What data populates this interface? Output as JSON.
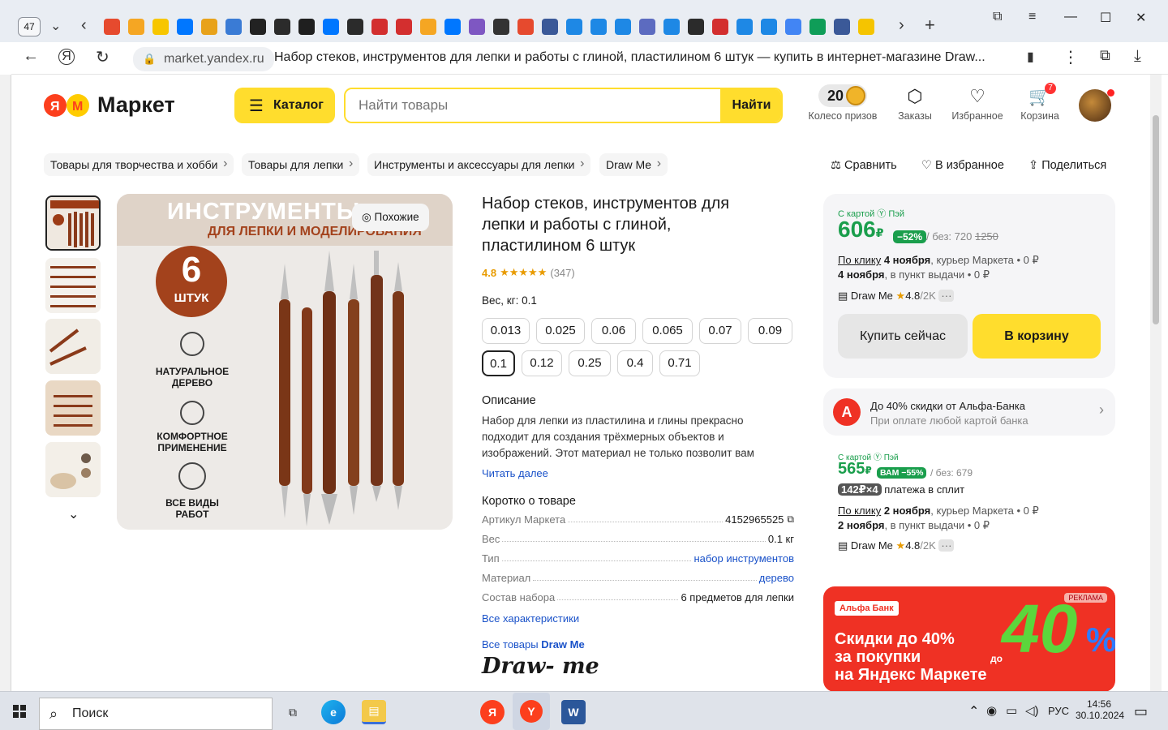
{
  "browser": {
    "tab_count": "47",
    "url": "market.yandex.ru",
    "page_title": "Набор стеков, инструментов для лепки и работы с глиной, пластилином 6 штук — купить в интернет-магазине Draw...",
    "favicon_colors": [
      "#e64a2e",
      "#f5a623",
      "#f7c600",
      "#0077ff",
      "#e8a21a",
      "#3a7bd5",
      "#222222",
      "#2b2b2b",
      "#1f1f1f",
      "#0077ff",
      "#2b2b2b",
      "#d32f2f",
      "#d32f2f",
      "#f5a623",
      "#0077ff",
      "#7e57c2",
      "#333333",
      "#e64a2e",
      "#3b5998",
      "#1e88e5",
      "#1e88e5",
      "#1e88e5",
      "#5c6bc0",
      "#1e88e5",
      "#2b2b2b",
      "#d32f2f",
      "#1e88e5",
      "#1e88e5",
      "#4285f4",
      "#0f9d58",
      "#3b5998",
      "#f5c400"
    ]
  },
  "header": {
    "logo_text": "Маркет",
    "catalog_label": "Каталог",
    "search_placeholder": "Найти товары",
    "search_button": "Найти",
    "wheel_count": "20",
    "wheel_label": "Колесо призов",
    "orders_label": "Заказы",
    "favorites_label": "Избранное",
    "cart_label": "Корзина",
    "cart_badge": "7"
  },
  "breadcrumbs": [
    "Товары для творчества и хобби",
    "Товары для лепки",
    "Инструменты и аксессуары для лепки",
    "Draw Me"
  ],
  "actions": {
    "compare": "Сравнить",
    "favorite": "В избранное",
    "share": "Поделиться"
  },
  "gallery": {
    "similar_label": "Похожие",
    "banner_title": "ИНСТРУМЕНТЫ",
    "banner_subtitle": "ДЛЯ ЛЕПКИ И МОДЕЛИРОВАНИЯ",
    "count_number": "6",
    "count_unit": "ШТУК",
    "features": [
      "НАТУРАЛЬНОЕ ДЕРЕВО",
      "КОМФОРТНОЕ ПРИМЕНЕНИЕ",
      "ВСЕ ВИДЫ РАБОТ"
    ]
  },
  "product": {
    "title": "Набор стеков, инструментов для лепки и работы с глиной, пластилином 6 штук",
    "rating": "4.8",
    "stars": 4.8,
    "reviews": "(347)",
    "weight_label": "Вес, кг: 0.1",
    "weights": [
      "0.013",
      "0.025",
      "0.06",
      "0.065",
      "0.07",
      "0.09",
      "0.1",
      "0.12",
      "0.25",
      "0.4",
      "0.71"
    ],
    "selected_weight": "0.1",
    "description_title": "Описание",
    "description": "Набор для лепки из пластилина и глины прекрасно подходит для создания трёхмерных объектов и изображений. Этот материал не только позволит вам",
    "read_more": "Читать далее",
    "short_title": "Коротко о товаре",
    "specs": [
      {
        "k": "Артикул Маркета",
        "v": "4152965525"
      },
      {
        "k": "Вес",
        "v": "0.1 кг"
      },
      {
        "k": "Тип",
        "v": "набор инструментов"
      },
      {
        "k": "Материал",
        "v": "дерево"
      },
      {
        "k": "Состав набора",
        "v": "6 предметов для лепки"
      }
    ],
    "all_specs": "Все характеристики",
    "all_goods_prefix": "Все товары",
    "brand": "Draw Me",
    "brand_logo_text": "Draw- me"
  },
  "offer1": {
    "card_label": "С картой",
    "pay_label": "Пэй",
    "price": "606",
    "currency": "₽",
    "discount": "−52%",
    "without_label": "/ без: 720",
    "old_price": "1250",
    "delivery1_link": "По клику",
    "delivery1_date": "4 ноября",
    "delivery1_rest": ", курьер Маркета • 0 ₽",
    "delivery2_date": "4 ноября",
    "delivery2_rest": ", в пункт выдачи • 0 ₽",
    "seller": "Draw Me",
    "seller_rating": "4.8",
    "seller_count": "/2K",
    "buy_now": "Купить сейчас",
    "to_cart": "В корзину"
  },
  "alfa_promo": {
    "title": "До 40% скидки от Альфа-Банка",
    "subtitle": "При оплате любой картой банка"
  },
  "offer2": {
    "card_label": "С картой",
    "pay_label": "Пэй",
    "price": "565",
    "currency": "₽",
    "discount": "ВАМ −55%",
    "without_label": "/ без: 679",
    "split_amount": "142₽×4",
    "split_label": "платежа в сплит",
    "delivery1_link": "По клику",
    "delivery1_date": "2 ноября",
    "delivery1_rest": ", курьер Маркета • 0 ₽",
    "delivery2_date": "2 ноября",
    "delivery2_rest": ", в пункт выдачи • 0 ₽",
    "seller": "Draw Me",
    "seller_rating": "4.8",
    "seller_count": "/2K"
  },
  "ad": {
    "badge": "РЕКЛАМА",
    "bank": "Альфа Банк",
    "line1": "Скидки до 40%",
    "line2": "за покупки",
    "line3": "на Яндекс Маркете",
    "big_prefix": "до",
    "big_number": "40",
    "big_unit": "%"
  },
  "taskbar": {
    "search": "Поиск",
    "lang": "РУС",
    "time": "14:56",
    "date": "30.10.2024"
  },
  "colors": {
    "accent": "#ffdd2d",
    "green": "#1a9e4c",
    "link": "#1a52c9",
    "alfa_red": "#ef3124"
  }
}
